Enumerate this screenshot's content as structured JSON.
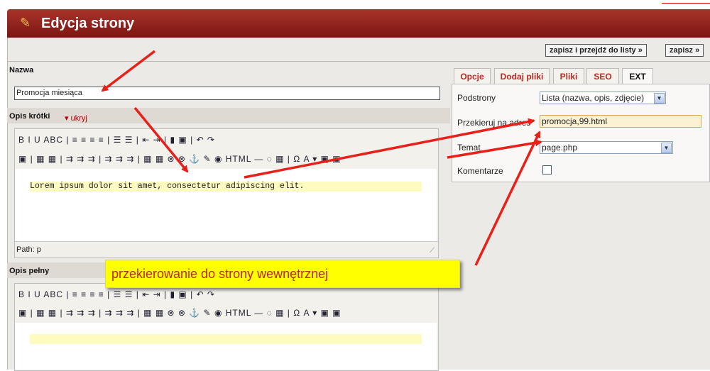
{
  "header": {
    "title": "Edycja strony",
    "icon": "pencil-icon"
  },
  "actions": {
    "save_list": "zapisz i przejdź do listy »",
    "save": "zapisz »"
  },
  "fields": {
    "name_label": "Nazwa",
    "name_value": "Promocja miesiąca",
    "short_label": "Opis krótki",
    "hide_link": "ukryj",
    "short_text": "Lorem ipsum dolor sit amet, consectetur adipiscing elit.",
    "path": "Path: p",
    "full_label": "Opis pełny"
  },
  "toolbar": {
    "row1": "B I U ABC | ≡ ≡ ≡ ≡ | ☰ ☰ | ⇤ ⇥ | ▮ ▣ | ↶ ↷",
    "row2": "▣ | ▦ ▦ | ⇉ ⇉ ⇉ | ⇉ ⇉ ⇉ | ▦ ▦ ⊗ ⊗ ⚓ ✎ ◉ HTML — ◌ ▦ | Ω A ▾ ▣ ▣"
  },
  "tabs": [
    "Opcje",
    "Dodaj pliki",
    "Pliki",
    "SEO",
    "EXT"
  ],
  "options": {
    "subpages_label": "Podstrony",
    "subpages_value": "Lista (nazwa, opis, zdjęcie)",
    "redirect_label": "Przekieruj na adres",
    "redirect_value": "promocja,99.html",
    "template_label": "Temat",
    "template_value": "page.php",
    "comments_label": "Komentarze"
  },
  "annotation": {
    "text": "przekierowanie do strony wewnętrznej"
  },
  "colors": {
    "header": "#8e1f1a",
    "tab_text": "#b82a22",
    "callout_bg": "#ffff00",
    "arrow": "#e8201a"
  }
}
